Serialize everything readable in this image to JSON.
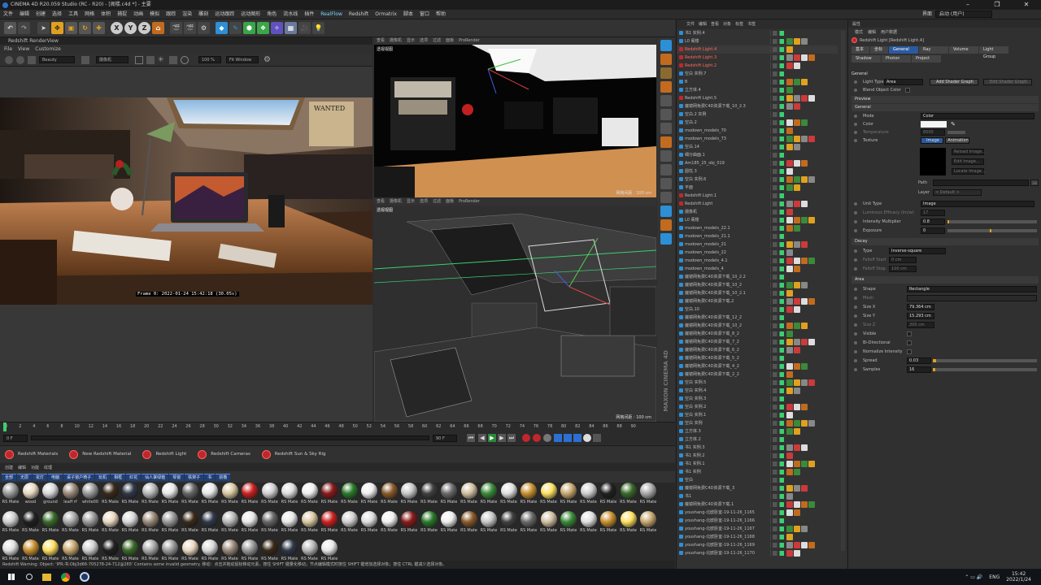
{
  "titlebar": {
    "title": "CINEMA 4D R20.059 Studio (RC - R20) - [阁楼.c4d *] - 主要",
    "interface_label": "界面",
    "interface_value": "启动 (用户)"
  },
  "menubar": [
    "文件",
    "编辑",
    "创建",
    "选择",
    "工具",
    "网格",
    "体积",
    "捕捉",
    "动画",
    "模拟",
    "跟踪",
    "渲染",
    "雕刻",
    "运动跟踪",
    "运动图形",
    "角色",
    "流水线",
    "插件",
    "RealFlow",
    "Redshift",
    "Ormatrix",
    "脚本",
    "窗口",
    "帮助"
  ],
  "renderview": {
    "title": "Redshift RenderView",
    "menu": [
      "File",
      "View",
      "Customize"
    ],
    "beauty": "Beauty",
    "camera": "摄像机",
    "zoom": "100 %",
    "fit": "Fit Window",
    "frame_info": "Frame  0:  2022-01-24  15:42:18  (30.05s)"
  },
  "viewport1": {
    "menu": [
      "查看",
      "摄像机",
      "显示",
      "选项",
      "过滤",
      "面板",
      "ProRender"
    ],
    "label": "透视视图",
    "grid": "网格间距 : 100 cm"
  },
  "viewport2": {
    "menu": [
      "查看",
      "摄像机",
      "显示",
      "选项",
      "过滤",
      "面板",
      "ProRender"
    ],
    "label": "透视视图",
    "grid": "网格间距 : 100 cm",
    "maxon": "MAXON CINEMA 4D"
  },
  "timeline": {
    "ticks": [
      "0",
      "2",
      "4",
      "6",
      "8",
      "10",
      "12",
      "14",
      "16",
      "18",
      "20",
      "22",
      "24",
      "26",
      "28",
      "30",
      "32",
      "34",
      "36",
      "38",
      "40",
      "42",
      "44",
      "46",
      "48",
      "50",
      "52",
      "54",
      "56",
      "58",
      "60",
      "62",
      "64",
      "66",
      "68",
      "70",
      "72",
      "74",
      "76",
      "78",
      "80",
      "82",
      "84",
      "86",
      "88",
      "90"
    ],
    "current_frame": "0 F",
    "start": "0 F",
    "end": "90 F",
    "end2": "90 F",
    "right_label": "0 F"
  },
  "redshift_bar": [
    "Redshift Materials",
    "New Redshift Material",
    "Redshift Light",
    "Redshift Cameras",
    "Redshift Sun & Sky Rig"
  ],
  "material_manager": {
    "menu": [
      "创建",
      "编辑",
      "功能",
      "纹理"
    ],
    "tabs": [
      "全部",
      "无层",
      "妆灯",
      "电脑",
      "桌子窗户椅子",
      "玩机",
      "相框",
      "红花",
      "仙人掌绿植",
      "琴窗",
      "铁架子",
      "书",
      "前檐"
    ],
    "row1": [
      "RS Mate",
      "wood",
      "ground",
      "leaff rf",
      "white00",
      "RS Mate",
      "RS Mate",
      "RS Mate",
      "RS Mate",
      "RS Mate",
      "RS Mate",
      "RS Mate",
      "RS Mate",
      "RS Mate",
      "RS Mate",
      "RS Mate",
      "RS Mate",
      "RS Mate",
      "RS Mate",
      "RS Mate",
      "RS Mate",
      "RS Mate",
      "RS Mate",
      "RS Mate",
      "RS Mate",
      "RS Mate",
      "RS Mate",
      "RS Mate",
      "RS Mate",
      "RS Mate",
      "RS Mate",
      "RS Mate",
      "RS Mate"
    ],
    "row2": [
      "RS Mate",
      "RS Mate",
      "RS Mate",
      "RS Mate",
      "RS Mate",
      "RS Mate",
      "RS Mate",
      "RS Mate",
      "RS Mate",
      "RS Mate",
      "RS Mate",
      "RS Mate",
      "RS Mate",
      "RS Mate",
      "RS Mate",
      "RS Mate",
      "RS Mate",
      "RS Mate",
      "RS Mate",
      "RS Mate",
      "RS Mate",
      "RS Mate",
      "RS Mate",
      "RS Mate",
      "RS Mate",
      "RS Mate",
      "RS Mate",
      "RS Mate",
      "RS Mate",
      "RS Mate",
      "RS Mate",
      "RS Mate",
      "RS Mate"
    ],
    "row3": [
      "RS Mate",
      "RS Mate",
      "RS Mate",
      "RS Mate",
      "RS Mate",
      "RS Mate",
      "RS Mate",
      "RS Mate",
      "RS Mate",
      "RS Mate",
      "RS Mate",
      "RS Mate",
      "RS Mate",
      "RS Mate",
      "RS Mate",
      "RS Mate",
      "RS Mate"
    ]
  },
  "statusbar": "Redshift Warning: Object: 'IPR:书:Obj3d66-705278-24-712@265' Contains some invalid geometry.    移动：点击并拖动鼠标移动元素。按住 SHIFT 键量化移动；节点编辑模式时按住 SHIFT 键增加选择对象；按住 CTRL 键减少选择对象。",
  "object_manager": {
    "menu": [
      "文件",
      "编辑",
      "查看",
      "对象",
      "标签",
      "书签"
    ],
    "rows": [
      "书1 实例.4",
      "L0 阁楼",
      "Redshift Light.4",
      "Redshift Light.3",
      "Redshift Light.2",
      "空白 实例.7",
      "B",
      "立方体.4",
      "Redshift Light.5",
      "魔镜网免费C4D资源下载_10_2.3",
      "空白.2 实例",
      "空白.2",
      "modown_models_70",
      "modown_models_73",
      "空白.14",
      "细分曲面.1",
      "Am185_25_obj_019",
      "圆柱.3",
      "空白 实例.6",
      "平面",
      "Redshift Light.1",
      "Redshift Light",
      "摄像机",
      "L0 阁楼",
      "modown_models_22.1",
      "modown_models_21.1",
      "modown_models_21",
      "modown_models_22",
      "modown_models_4.1",
      "modown_models_4",
      "魔镜网免费C4D资源下载_10_2.2",
      "魔镜网免费C4D资源下载_10_2",
      "魔镜网免费C4D资源下载_10_2.1",
      "魔镜网免费C4D资源下载.2",
      "空白.10",
      "魔镜网免费C4D资源下载_12_2",
      "魔镜网免费C4D资源下载_10_2",
      "魔镜网免费C4D资源下载_8_2",
      "魔镜网免费C4D资源下载_7_2",
      "魔镜网免费C4D资源下载_6_2",
      "魔镜网免费C4D资源下载_5_2",
      "魔镜网免费C4D资源下载_4_2",
      "魔镜网免费C4D资源下载_2_2",
      "空白 实例.5",
      "空白 实例.4",
      "空白 实例.3",
      "空白 实例.2",
      "空白 实例.1",
      "空白 实例",
      "立方体.3",
      "立方体.2",
      "书1 实例.3",
      "书1 实例.2",
      "书1 实例.1",
      "书1 实例",
      "空白",
      "魔镜网免费C4D资源下载_3",
      "书1",
      "魔镜网免费C4D资源下载.1",
      "youshang-北欧卧室-19-11-26_1165",
      "youshang-北欧卧室-19-11-26_1166",
      "youshang-北欧卧室-19-11-26_1167",
      "youshang-北欧卧室-19-11-26_1168",
      "youshang-北欧卧室-19-11-26_1169",
      "youshang-北欧卧室-19-11-26_1170"
    ]
  },
  "attributes": {
    "menu": [
      "模式",
      "编辑",
      "用户数据"
    ],
    "header": "属性",
    "object": "Redshift Light [Redshift Light.4]",
    "tabs_row1": [
      "基本",
      "坐标",
      "General",
      "Ray",
      "Volume",
      "Light Group"
    ],
    "tabs_row2": [
      "Shadow",
      "Photon",
      "Project"
    ],
    "section_general": "General",
    "light_type_label": "Light Type",
    "light_type": "Area",
    "add_shader": "Add Shader Graph",
    "edit_shader": "Edit Shader Graph",
    "blend_label": "Blend Object Color",
    "preview": "Preview",
    "general": "General",
    "mode_label": "Mode",
    "mode": "Color",
    "color_label": "Color",
    "temperature_label": "Temperature",
    "temperature": "6500",
    "texture_label": "Texture",
    "image_tab": "Image",
    "animation_tab": "Animation",
    "reload": "Reload Image...",
    "edit_image": "Edit Image...",
    "locate": "Locate Image...",
    "path_label": "Path",
    "path_btn": "...",
    "layer_label": "Layer",
    "layer": "< Default >",
    "unit_type_label": "Unit Type",
    "unit_type": "Image",
    "luminous_label": "Luminous Efficacy (lm/w)",
    "luminous": "17",
    "intensity_label": "Intensity Multiplier",
    "intensity": "0.8",
    "exposure_label": "Exposure",
    "exposure": "0",
    "decay": "Decay",
    "type_label": "Type",
    "type": "Inverse-square",
    "falloff_start_label": "Falloff Start",
    "falloff_start": "0 cm",
    "falloff_stop_label": "Falloff Stop",
    "falloff_stop": "100 cm",
    "area": "Area",
    "shape_label": "Shape",
    "shape": "Rectangle",
    "mesh_label": "Mesh",
    "size_x_label": "Size X",
    "size_x": "79.364 cm",
    "size_y_label": "Size Y",
    "size_y": "15.293 cm",
    "size_z_label": "Size Z",
    "size_z": "200 cm",
    "visible_label": "Visible",
    "bidir_label": "Bi-Directional",
    "normalize_label": "Normalize Intensity",
    "spread_label": "Spread",
    "spread": "0.03",
    "samples_label": "Samples",
    "samples": "16"
  },
  "taskbar": {
    "time": "15:42",
    "date": "2022/1/24",
    "lang": "ENG"
  }
}
